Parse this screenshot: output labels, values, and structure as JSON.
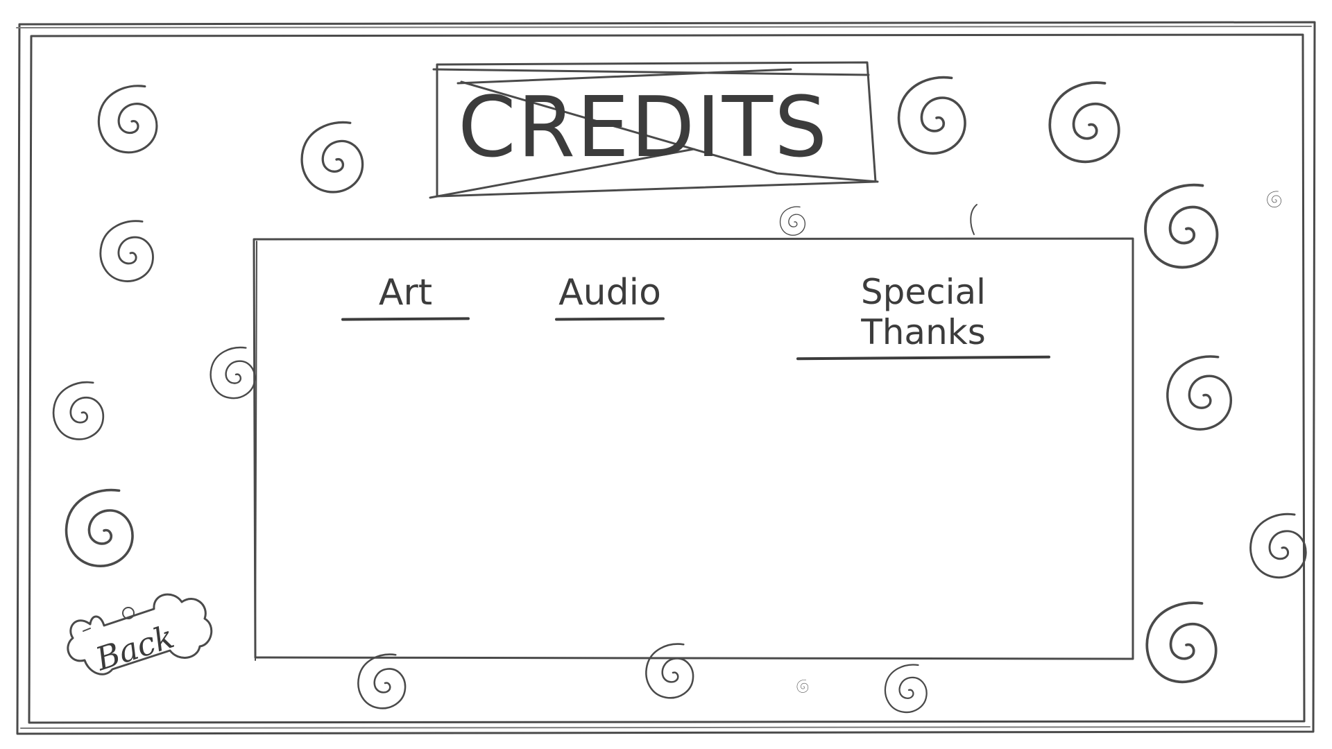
{
  "screen": {
    "title": "CREDITS"
  },
  "tabs": [
    {
      "id": "art",
      "label": "Art"
    },
    {
      "id": "audio",
      "label": "Audio"
    },
    {
      "id": "special_thanks",
      "label": "Special Thanks"
    }
  ],
  "back_button": {
    "label": "Back",
    "icon": "bone-icon"
  },
  "decorations": {
    "icon": "swirl-icon"
  },
  "colors": {
    "ink": "#3c3c3c",
    "paper": "#ffffff"
  }
}
